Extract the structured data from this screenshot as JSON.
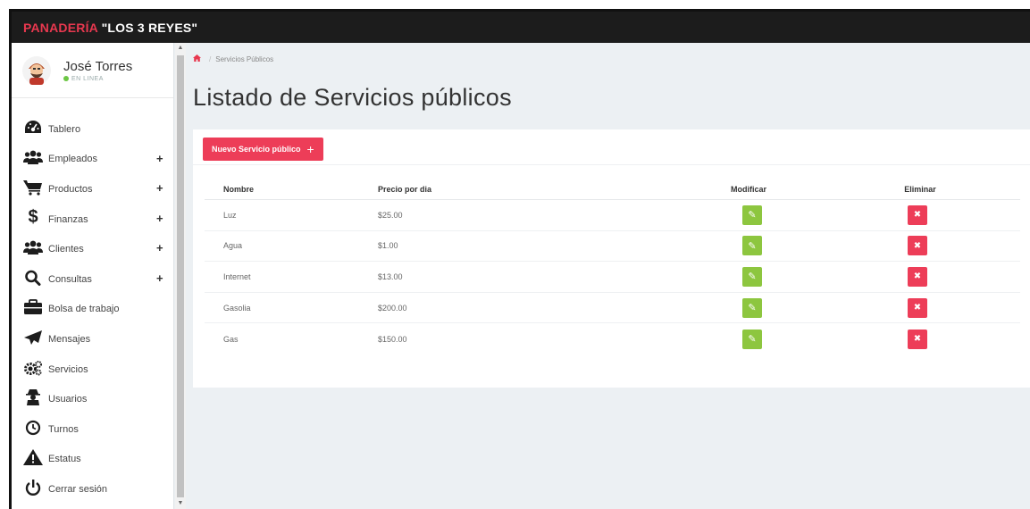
{
  "app": {
    "brand_red": "PANADERÍA",
    "brand_white": "\"LOS 3 REYES\""
  },
  "user": {
    "name": "José Torres",
    "status": "EN LINEA"
  },
  "sidebar": {
    "items": [
      {
        "label": "Tablero",
        "icon": "dashboard-icon",
        "expandable": false
      },
      {
        "label": "Empleados",
        "icon": "users-icon",
        "expandable": true
      },
      {
        "label": "Productos",
        "icon": "cart-icon",
        "expandable": true
      },
      {
        "label": "Finanzas",
        "icon": "dollar-icon",
        "expandable": true
      },
      {
        "label": "Clientes",
        "icon": "users-icon",
        "expandable": true
      },
      {
        "label": "Consultas",
        "icon": "search-icon",
        "expandable": true
      },
      {
        "label": "Bolsa de trabajo",
        "icon": "briefcase-icon",
        "expandable": false
      },
      {
        "label": "Mensajes",
        "icon": "paper-plane-icon",
        "expandable": false
      },
      {
        "label": "Servicios",
        "icon": "cogs-icon",
        "expandable": false
      },
      {
        "label": "Usuarios",
        "icon": "user-secret-icon",
        "expandable": false
      },
      {
        "label": "Turnos",
        "icon": "clock-icon",
        "expandable": false
      },
      {
        "label": "Estatus",
        "icon": "warning-icon",
        "expandable": false
      },
      {
        "label": "Cerrar sesión",
        "icon": "power-icon",
        "expandable": false
      }
    ],
    "plus_symbol": "+"
  },
  "breadcrumb": {
    "current": "Servicios Públicos",
    "separator": "/"
  },
  "page": {
    "title": "Listado de Servicios públicos",
    "new_button_label": "Nuevo Servicio público",
    "new_button_plus": "+"
  },
  "table": {
    "headers": {
      "name": "Nombre",
      "price": "Precio por dia",
      "modify": "Modificar",
      "delete": "Eliminar"
    },
    "rows": [
      {
        "name": "Luz",
        "price": "$25.00"
      },
      {
        "name": "Agua",
        "price": "$1.00"
      },
      {
        "name": "Internet",
        "price": "$13.00"
      },
      {
        "name": "Gasolia",
        "price": "$200.00"
      },
      {
        "name": "Gas",
        "price": "$150.00"
      }
    ],
    "edit_glyph": "✎",
    "delete_glyph": "✖"
  },
  "colors": {
    "brand_red": "#e8384f",
    "topbar": "#1c1c1c",
    "edit_green": "#8dc63f",
    "delete_red": "#ed3d58",
    "status_green": "#6cc644"
  }
}
